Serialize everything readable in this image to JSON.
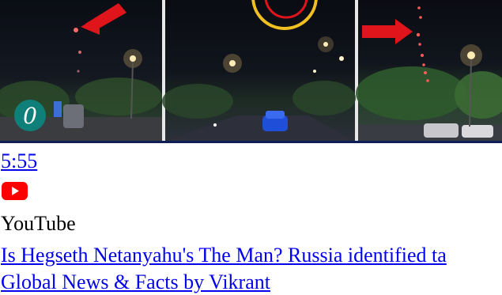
{
  "video": {
    "duration": "5:55",
    "source_icon": "youtube-play-icon",
    "source": "YouTube",
    "title": "Is Hegseth Netanyahu's The Man? Russia identified ta",
    "channel": "Global News & Facts by Vikrant"
  },
  "colors": {
    "link": "#0000ee",
    "youtube_red": "#ff0000",
    "thumbnail_border": "#0f1f55"
  }
}
